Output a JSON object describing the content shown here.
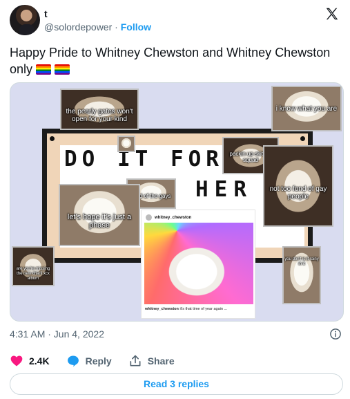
{
  "user": {
    "display_name": "t",
    "handle": "@solordepower",
    "separator": "·",
    "follow_label": "Follow"
  },
  "tweet": {
    "text": "Happy Pride to Whitney Chewston and Whitney Chewston only",
    "emoji": [
      "rainbow-flag",
      "rainbow-flag"
    ]
  },
  "media": {
    "sign_line1": "DO  IT FOR",
    "sign_line2": "HER",
    "stickers": [
      "the pearly gates won't open for your kind",
      "i know what you are",
      "packin up skittles squad",
      "tired of the gays",
      "not too fond of gay people",
      "let's hope it's just a phase",
      "are you're missing the new charli xcx album",
      "you don't is it rainy in it"
    ],
    "post": {
      "username": "whitney_chewston",
      "caption_user": "whitney_chewston",
      "caption_text": "it's that time of year again ..."
    }
  },
  "meta": {
    "timestamp": "4:31 AM · Jun 4, 2022"
  },
  "actions": {
    "likes": "2.4K",
    "reply_label": "Reply",
    "share_label": "Share"
  },
  "read_replies_label": "Read 3 replies",
  "colors": {
    "accent": "#1d9bf0",
    "like": "#f91880",
    "text": "#0f1419",
    "muted": "#536471"
  }
}
